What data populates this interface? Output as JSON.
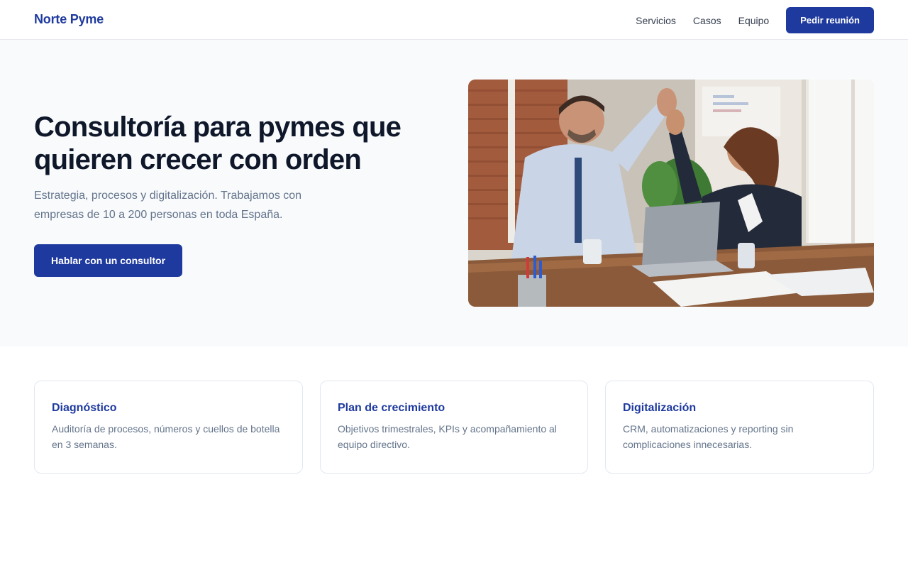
{
  "header": {
    "brand": "Norte Pyme",
    "nav": [
      {
        "label": "Servicios"
      },
      {
        "label": "Casos"
      },
      {
        "label": "Equipo"
      }
    ],
    "cta_label": "Pedir reunión"
  },
  "hero": {
    "title": "Consultoría para pymes que quieren crecer con orden",
    "subtitle": "Estrategia, procesos y digitalización. Trabajamos con empresas de 10 a 200 personas en toda España.",
    "cta_label": "Hablar con un consultor",
    "image": "photo-office-high-five"
  },
  "services": [
    {
      "title": "Diagnóstico",
      "text": "Auditoría de procesos, números y cuellos de botella en 3 semanas."
    },
    {
      "title": "Plan de crecimiento",
      "text": "Objetivos trimestrales, KPIs y acompañamiento al equipo directivo."
    },
    {
      "title": "Digitalización",
      "text": "CRM, automatizaciones y reporting sin complicaciones innecesarias."
    }
  ],
  "colors": {
    "brand": "#1e3a9e",
    "heading": "#0f172a",
    "muted": "#64748b",
    "hero_bg": "#f8fafc",
    "border": "#e2e8f0"
  }
}
